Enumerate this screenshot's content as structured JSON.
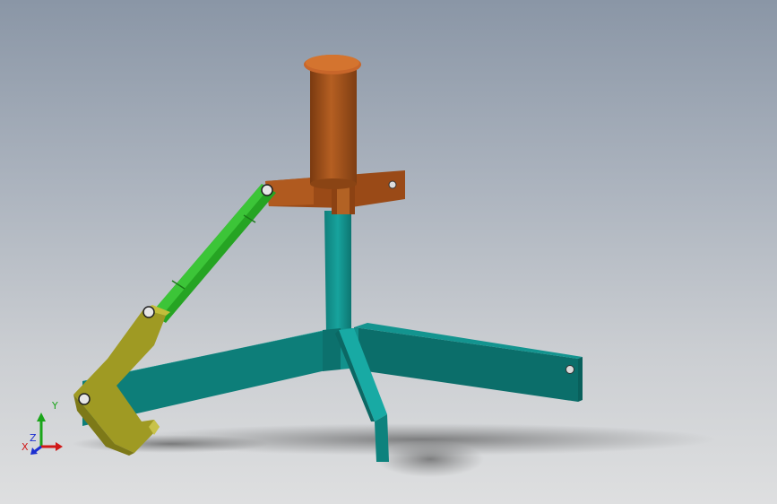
{
  "viewport": {
    "background_top": "#8a96a6",
    "background_bottom": "#dedfe0"
  },
  "parts": {
    "base_frame_color": "#0e8b86",
    "column_color": "#139994",
    "sleeve_color": "#a0501a",
    "link_color": "#2fb52c",
    "hook_color": "#a8a326",
    "pin_color": "#d8d8d8"
  },
  "triad": {
    "x_label": "X",
    "y_label": "Y",
    "z_label": "Z",
    "x_color": "#d01818",
    "y_color": "#1aa51a",
    "z_color": "#1c2fd0"
  }
}
